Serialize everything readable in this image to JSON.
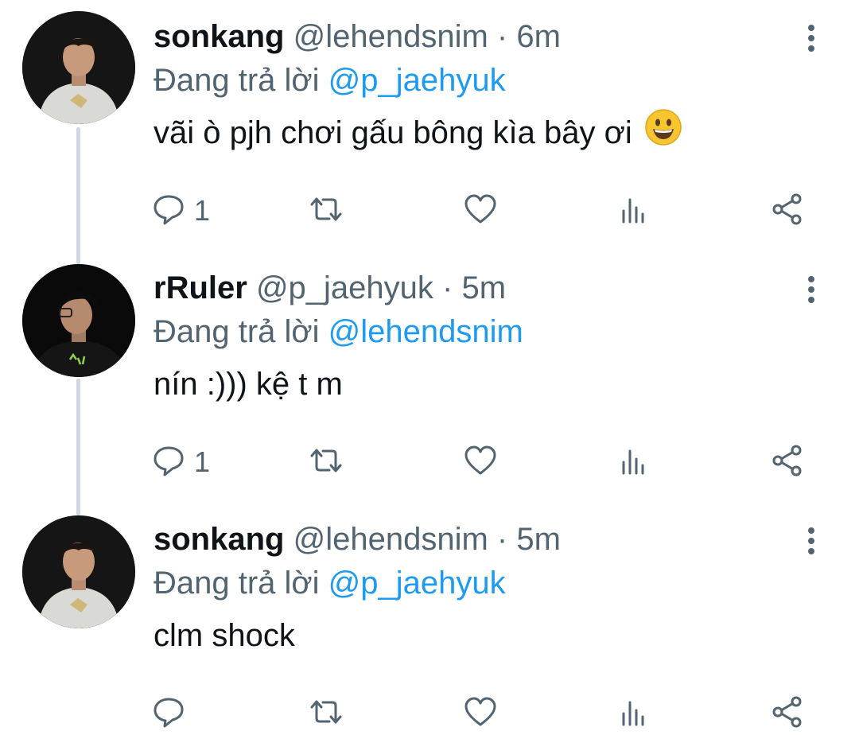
{
  "tweets": [
    {
      "display_name": "sonkang",
      "handle": "@lehendsnim",
      "separator": "·",
      "time": "6m",
      "reply_prefix": "Đang trả lời",
      "reply_to": "@p_jaehyuk",
      "text": "vãi ò pjh chơi gấu bông kìa bây ơi",
      "emoji": "grinning-face-emoji",
      "reply_count": "1",
      "avatar": "avatar-white-shirt"
    },
    {
      "display_name": "rRuler",
      "handle": "@p_jaehyuk",
      "separator": "·",
      "time": "5m",
      "reply_prefix": "Đang trả lời",
      "reply_to": "@lehendsnim",
      "text": "nín :))) kệ t m",
      "reply_count": "1",
      "avatar": "avatar-black-hoodie"
    },
    {
      "display_name": "sonkang",
      "handle": "@lehendsnim",
      "separator": "·",
      "time": "5m",
      "reply_prefix": "Đang trả lời",
      "reply_to": "@p_jaehyuk",
      "text": "clm shock",
      "reply_count": "",
      "avatar": "avatar-white-shirt"
    }
  ],
  "icons": {
    "reply": "reply-icon",
    "retweet": "retweet-icon",
    "like": "like-icon",
    "views": "views-icon",
    "share": "share-icon",
    "more": "more-options-icon"
  },
  "colors": {
    "mention": "#1d9bf0",
    "secondary_text": "#536471",
    "primary_text": "#0f1419",
    "thread_line": "#cfd9de"
  }
}
